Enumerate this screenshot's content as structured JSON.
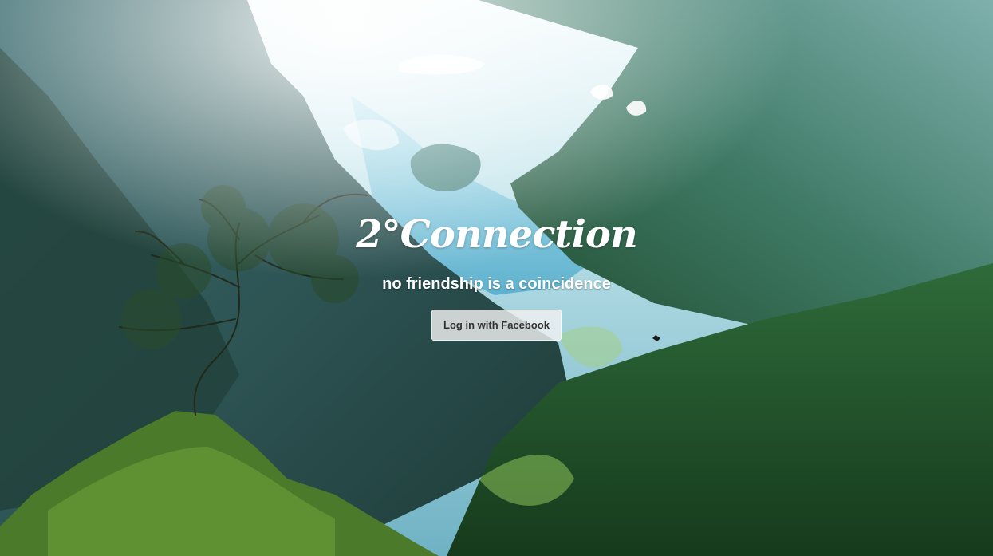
{
  "app": {
    "title": "2°Connection",
    "tagline": "no friendship is a coincidence"
  },
  "login": {
    "button_label": "Log in with Facebook"
  },
  "background": {
    "image": "mountain-valley-landscape"
  },
  "colors": {
    "title_text": "#ffffff",
    "button_bg": "#f0f0f0",
    "button_text": "#333333"
  }
}
